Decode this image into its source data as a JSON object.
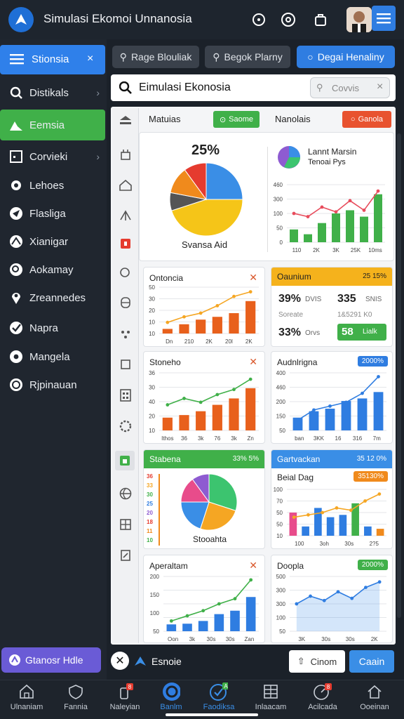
{
  "app": {
    "title": "Simulasi Ekomoi Unnanosia"
  },
  "topbar": {
    "icons": [
      "search-icon",
      "settings-icon",
      "bag-icon",
      "avatar",
      "menu-icon"
    ]
  },
  "sidebar": {
    "header_label": "Stionsia",
    "items": [
      {
        "label": "Distikals",
        "icon": "search-icon",
        "chevron": true
      },
      {
        "label": "Eemsia",
        "icon": "chart-icon",
        "active": true
      },
      {
        "label": "Corvieki",
        "icon": "square-icon",
        "chevron": true
      },
      {
        "label": "Lehoes",
        "icon": "gear-icon"
      },
      {
        "label": "Flasliga",
        "icon": "send-icon"
      },
      {
        "label": "Xianigar",
        "icon": "compass-icon"
      },
      {
        "label": "Aokamay",
        "icon": "search-circle-icon"
      },
      {
        "label": "Zreannedes",
        "icon": "pin-icon"
      },
      {
        "label": "Napra",
        "icon": "check-icon"
      },
      {
        "label": "Mangela",
        "icon": "eye-icon"
      },
      {
        "label": "Rjpinauan",
        "icon": "clock-icon"
      }
    ],
    "footer_label": "Gtanosr Hdle"
  },
  "tabs": [
    {
      "label": "Rage Blouliak",
      "icon": "pin-icon"
    },
    {
      "label": "Begok Plarny",
      "icon": "pin-icon"
    },
    {
      "label": "Degai Henaliny",
      "icon": "circle-icon",
      "active": true
    }
  ],
  "search": {
    "title": "Eimulasi Ekonosia",
    "field_value": "Covvis"
  },
  "panel_header": {
    "left": "Matuias",
    "btn_green": "Saome",
    "middle": "Nanolais",
    "btn_red": "Ganola"
  },
  "main_card": {
    "pie_percent": "25%",
    "pie_label": "Svansa Aid",
    "legend_title_1": "Lannt Marsin",
    "legend_title_2": "Tenoai Pys",
    "bar_xticks": [
      "110",
      "2K",
      "3K",
      "25K",
      "10ms"
    ],
    "bar_yticks": [
      "460",
      "300",
      "100",
      "50",
      "0"
    ]
  },
  "cards": {
    "c1": {
      "title": "Ontoncia",
      "yticks": [
        "50",
        "30",
        "20",
        "10",
        "10"
      ],
      "xticks": [
        "Dn",
        "210",
        "2K",
        "20l",
        "2K"
      ]
    },
    "c2": {
      "title": "Oaunium",
      "badge": "25 15%",
      "v1": "39%",
      "l1": "DVIS",
      "v2": "335",
      "l2": "SNIS",
      "sub1": "Soreate",
      "sub2": "1&5291 K0",
      "v3": "33%",
      "l3": "Orvs",
      "v4": "58",
      "l4": "Lialk"
    },
    "c3": {
      "title": "Stoneho",
      "yticks": [
        "36",
        "30",
        "40",
        "20",
        "10"
      ],
      "xticks": [
        "Ithos",
        "36",
        "3k",
        "76",
        "3k",
        "Zn"
      ]
    },
    "c4": {
      "title": "Audnlrigna",
      "badge": "2000%",
      "yticks": [
        "400",
        "460",
        "200",
        "150",
        "50"
      ],
      "xticks": [
        "ban",
        "3KK",
        "16",
        "316",
        "7m"
      ]
    },
    "c5": {
      "title": "Stabena",
      "badge": "33% 5%",
      "pie_label": "Stooahta",
      "yticks": [
        "36",
        "33",
        "30",
        "25",
        "20",
        "18",
        "11",
        "10"
      ]
    },
    "c6": {
      "title": "Gartvackan",
      "badge": "35 12 0%",
      "subtitle": "Beial Dag",
      "badge2": "35130%",
      "yticks": [
        "100",
        "70",
        "50",
        "50",
        "10"
      ],
      "xticks": [
        "100",
        "3oh",
        "30s",
        "2?5"
      ]
    },
    "c7": {
      "title": "Aperaltam",
      "yticks": [
        "200",
        "150",
        "100",
        "50"
      ],
      "xticks": [
        "Oon",
        "3k",
        "30s",
        "30s",
        "Zan"
      ]
    },
    "c8": {
      "title": "Doopla",
      "badge": "2000%",
      "yticks": [
        "500",
        "300",
        "300",
        "100",
        "50"
      ],
      "xticks": [
        "3K",
        "30s",
        "30s",
        "2K"
      ]
    }
  },
  "chart_data": [
    {
      "type": "pie",
      "values": [
        25,
        45,
        8,
        12,
        10
      ],
      "labels": [],
      "colors": [
        "#3a8ee6",
        "#f5c518",
        "#555",
        "#f08a1c",
        "#e53b2f"
      ]
    },
    {
      "type": "bar",
      "categories": [
        "110",
        "2K",
        "3K",
        "25K",
        "10ms"
      ],
      "values": [
        40,
        25,
        60,
        90,
        100,
        80,
        150
      ],
      "line": [
        90,
        80,
        110,
        95,
        130,
        100,
        160
      ]
    },
    {
      "type": "bar",
      "values": [
        5,
        10,
        15,
        18,
        22,
        35
      ],
      "line": [
        12,
        18,
        22,
        30,
        40,
        45
      ]
    },
    {
      "type": "bar",
      "values": [
        10,
        12,
        15,
        20,
        25,
        33
      ],
      "line": [
        20,
        25,
        22,
        28,
        32,
        40
      ]
    },
    {
      "type": "bar",
      "values": [
        100,
        150,
        170,
        230,
        250,
        300
      ],
      "line": [
        80,
        160,
        190,
        220,
        290,
        420
      ]
    },
    {
      "type": "pie",
      "values": [
        30,
        25,
        20,
        15,
        10
      ],
      "colors": [
        "#3cc46f",
        "#f5a623",
        "#3a8ee6",
        "#e84c8b",
        "#8e5bd1"
      ]
    },
    {
      "type": "bar",
      "values": [
        50,
        20,
        60,
        40,
        45,
        70,
        20,
        15
      ],
      "line": [
        40,
        45,
        50,
        60,
        55,
        75,
        90
      ]
    },
    {
      "type": "bar",
      "values": [
        20,
        22,
        30,
        50,
        60,
        100
      ],
      "line": [
        30,
        45,
        60,
        80,
        95,
        150
      ]
    },
    {
      "type": "area",
      "values": [
        250,
        320,
        280,
        360,
        300,
        400,
        450
      ]
    }
  ],
  "bottom_bar": {
    "left_label": "Esnoie",
    "secondary": "Cinom",
    "primary": "Caain"
  },
  "bottomnav": [
    {
      "label": "Ulnaniam",
      "icon": "home-icon"
    },
    {
      "label": "Fannia",
      "icon": "shield-icon"
    },
    {
      "label": "Naleyian",
      "icon": "bottle-icon",
      "badge": "8"
    },
    {
      "label": "Banlm",
      "icon": "ring-icon",
      "active": true
    },
    {
      "label": "Faodiksa",
      "icon": "check-icon",
      "active": true
    },
    {
      "label": "Inlaacam",
      "icon": "grid-icon"
    },
    {
      "label": "Acilcada",
      "icon": "gauge-icon",
      "badge": "8"
    },
    {
      "label": "Ooeinan",
      "icon": "house-icon"
    }
  ]
}
